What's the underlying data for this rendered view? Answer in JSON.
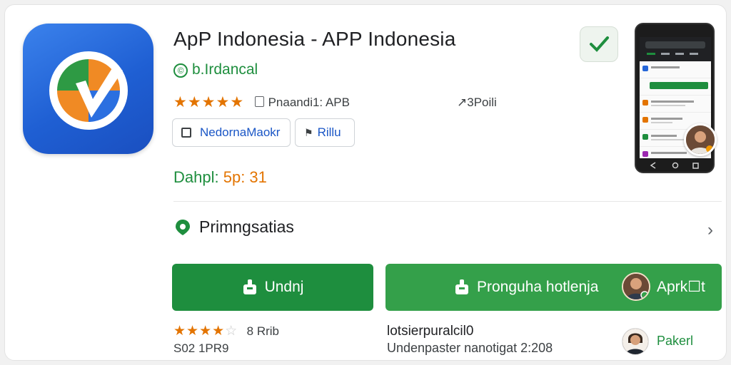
{
  "app": {
    "title": "ApP Indonesia - APP Indonesia",
    "developer": "b.Irdancal",
    "developer_symbol": "©",
    "rating_stars": 4.5,
    "rating_meta": "Pnaandi1: APB",
    "size_info": "↗3Poili",
    "chip_primary": "NedornaMaokr",
    "chip_secondary": "Rillu",
    "contains_label": "Dahpl:",
    "contains_value": "5p: 31",
    "icon_name": "app-logo-icon",
    "verified_icon": "check-shield-icon"
  },
  "section": {
    "label": "Primngsatias",
    "icon": "location-pin-icon",
    "chevron": "›"
  },
  "actions": {
    "download_label": "Undnj",
    "install_label": "Pronguha hotlenja",
    "install_extra": "Aprk☐t"
  },
  "review": {
    "stars": 3.5,
    "count": "8 Rrib",
    "code": "S02 1PR9",
    "title": "lotsierpuralcil0",
    "subtitle": "Undenpaster nanotigat 2:208",
    "link": "Pakerl"
  },
  "colors": {
    "accent_green": "#1e8e3e",
    "button_green": "#34a04a",
    "star_orange": "#e37400",
    "icon_blue": "#2566d8"
  }
}
